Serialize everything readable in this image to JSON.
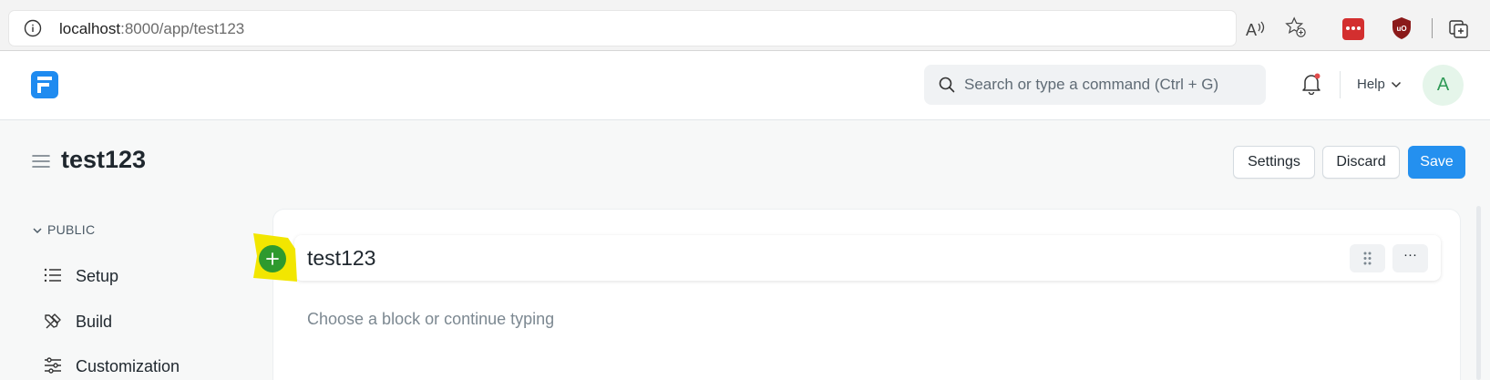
{
  "browser": {
    "url_host": "localhost",
    "url_rest": ":8000/app/test123"
  },
  "header": {
    "search_placeholder": "Search or type a command (Ctrl + G)",
    "help_label": "Help",
    "avatar_initial": "A"
  },
  "page": {
    "title": "test123",
    "settings_label": "Settings",
    "discard_label": "Discard",
    "save_label": "Save"
  },
  "sidebar": {
    "section_label": "PUBLIC",
    "items": [
      {
        "label": "Setup",
        "icon": "list-icon"
      },
      {
        "label": "Build",
        "icon": "tools-icon"
      },
      {
        "label": "Customization",
        "icon": "sliders-icon"
      }
    ]
  },
  "editor": {
    "block_title": "test123",
    "more_label": "···",
    "placeholder": "Choose a block or continue typing"
  },
  "colors": {
    "primary": "#2490ef",
    "add_button": "#2e9a2e",
    "highlight": "#f2e600"
  }
}
